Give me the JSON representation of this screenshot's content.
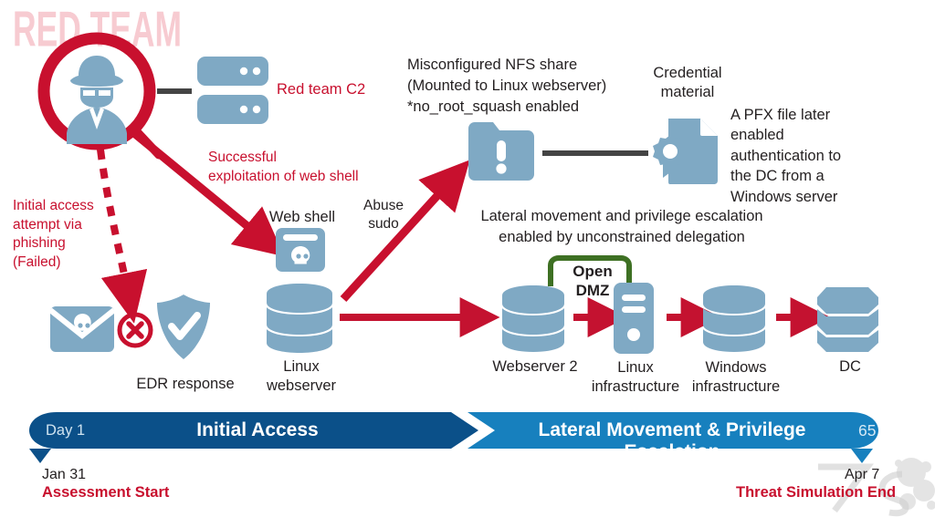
{
  "watermark": {
    "red_team_text": "RED TEAM",
    "corner_mark": "7"
  },
  "colors": {
    "icon_blue": "#7FA9C4",
    "red": "#C8102E",
    "arrow_red": "#C41230",
    "dark_gray": "#444444",
    "green": "#3E7023",
    "navy": "#0B5089",
    "blue": "#1780BE",
    "watermark_pink": "#F7CBD1",
    "text_black": "#231f20"
  },
  "nodes": {
    "attacker": {
      "name": "attacker-spy",
      "icon": "spy-magnifier-icon"
    },
    "c2": {
      "label": "Red team C2",
      "icon": "server-rack-icon"
    },
    "phishing_email": {
      "icon": "email-skull-icon"
    },
    "blocked": {
      "icon": "red-x-circle-icon"
    },
    "edr": {
      "label": "EDR response",
      "icon": "shield-check-icon"
    },
    "web_shell": {
      "label": "Web shell",
      "icon": "browser-skull-icon"
    },
    "linux_webserver": {
      "label": "Linux\nwebserver",
      "icon": "database-cylinder-icon"
    },
    "nfs_share": {
      "icon": "folder-alert-icon"
    },
    "credential": {
      "label": "Credential\nmaterial",
      "icon": "certificate-document-icon"
    },
    "webserver2": {
      "label": "Webserver 2",
      "icon": "database-cylinder-icon"
    },
    "linux_infra": {
      "label": "Linux\ninfrastructure",
      "icon": "server-tower-icon"
    },
    "windows_infra": {
      "label": "Windows\ninfrastructure",
      "icon": "database-cylinder-icon"
    },
    "dc": {
      "label": "DC",
      "icon": "database-cylinder-icon"
    }
  },
  "annotations": {
    "initial_access": "Initial access\nattempt via\nphishing\n(Failed)",
    "successful_exploit": "Successful\nexploitation of web shell",
    "abuse_sudo": "Abuse\nsudo",
    "nfs_share": "Misconfigured NFS share\n(Mounted to Linux webserver)\n*no_root_squash enabled",
    "pfx_file": "A PFX file later\nenabled\nauthentication to\nthe DC from a\nWindows server",
    "lateral_movement": "Lateral movement and privilege escalation\nenabled by unconstrained delegation",
    "open_dmz": "Open\nDMZ"
  },
  "timeline": {
    "phase1": {
      "day": "Day 1",
      "title": "Initial Access"
    },
    "phase2": {
      "title": "Lateral Movement & Privilege Escalation",
      "day": "65"
    },
    "start": {
      "date": "Jan 31",
      "label": "Assessment Start"
    },
    "end": {
      "date": "Apr 7",
      "label": "Threat Simulation End"
    }
  }
}
